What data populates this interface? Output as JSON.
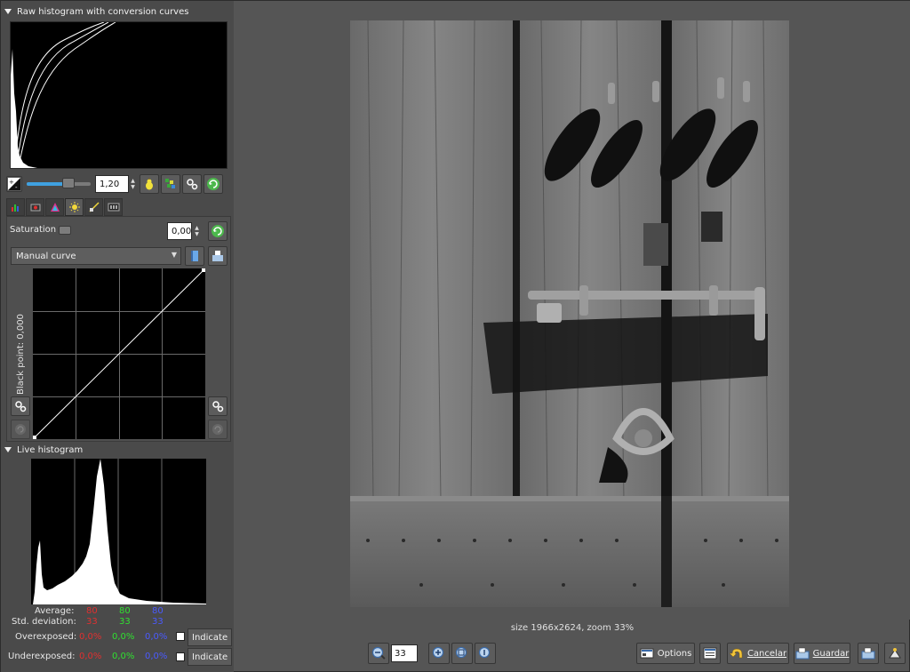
{
  "raw_histogram": {
    "title": "Raw histogram with conversion curves",
    "exposure_value": "1,20"
  },
  "tool_panel": {
    "saturation_label": "Saturation",
    "saturation_value": "0,00",
    "curve_preset": "Manual curve",
    "black_point_label": "Black point: 0,000"
  },
  "live_histogram": {
    "title": "Live histogram",
    "average_label": "Average:",
    "stddev_label": "Std. deviation:",
    "overexposed_label": "Overexposed:",
    "underexposed_label": "Underexposed:",
    "average": {
      "r": "80",
      "g": "80",
      "b": "80"
    },
    "stddev": {
      "r": "33",
      "g": "33",
      "b": "33"
    },
    "overexposed": {
      "r": "0,0%",
      "g": "0,0%",
      "b": "0,0%"
    },
    "underexposed": {
      "r": "0,0%",
      "g": "0,0%",
      "b": "0,0%"
    },
    "indicate_label": "Indicate"
  },
  "viewer": {
    "status_text": "size 1966x2624, zoom 33%"
  },
  "bottom_bar": {
    "zoom_value": "33",
    "options_label": "Options",
    "cancel_label": "Cancelar",
    "save_label": "Guardar"
  },
  "colors": {
    "accent": "#3fa1e0",
    "red": "#e03030",
    "green": "#30e030",
    "blue": "#4a5aff"
  }
}
